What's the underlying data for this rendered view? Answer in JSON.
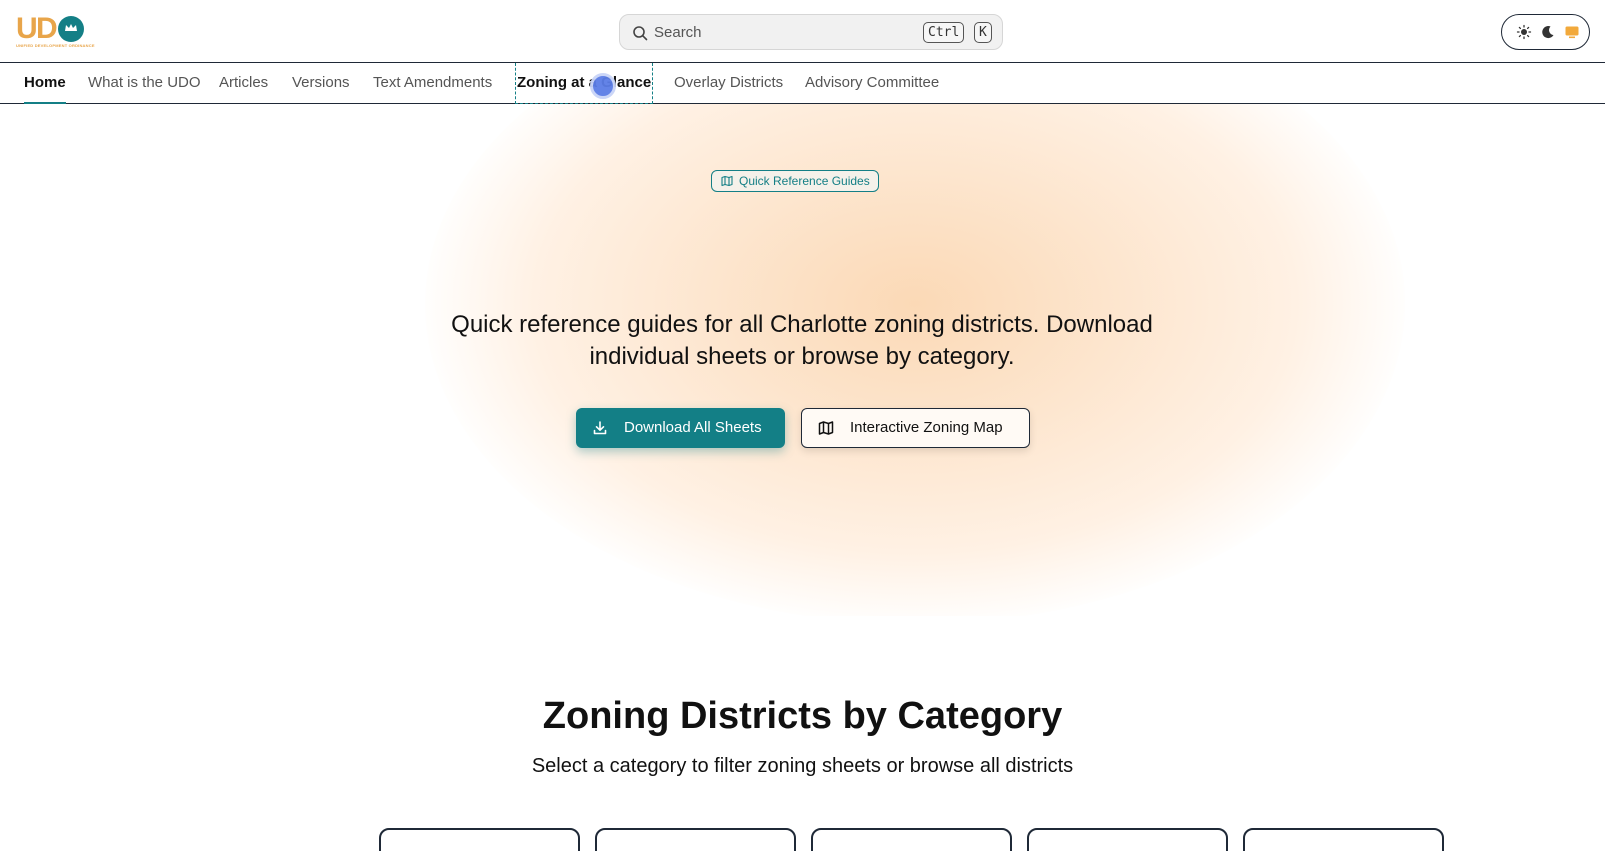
{
  "header": {
    "logo": {
      "letters": "UDO",
      "tagline": "UNIFIED DEVELOPMENT ORDINANCE"
    },
    "search": {
      "placeholder": "Search",
      "shortcut_keys": [
        "Ctrl",
        "K"
      ]
    },
    "theme_toggle": {
      "options": [
        "light-icon",
        "dark-icon",
        "system-icon"
      ],
      "selected": "system"
    }
  },
  "nav": {
    "items": [
      {
        "label": "Home",
        "state": "active"
      },
      {
        "label": "What is the UDO"
      },
      {
        "label": "Articles"
      },
      {
        "label": "Versions"
      },
      {
        "label": "Text Amendments"
      },
      {
        "label": "Zoning at a Glance",
        "state": "hovered"
      },
      {
        "label": "Overlay Districts"
      },
      {
        "label": "Advisory Committee"
      }
    ]
  },
  "hero": {
    "badge": "Quick Reference Guides",
    "text": "Quick reference guides for all Charlotte zoning districts. Download individual sheets or browse by category.",
    "primary_button": "Download All Sheets",
    "secondary_button": "Interactive Zoning Map"
  },
  "section": {
    "title": "Zoning Districts by Category",
    "subtitle": "Select a category to filter zoning sheets or browse all districts"
  },
  "colors": {
    "brand_teal": "#137f86",
    "brand_orange": "#e8a54a",
    "glow": "#fbd9b6"
  }
}
